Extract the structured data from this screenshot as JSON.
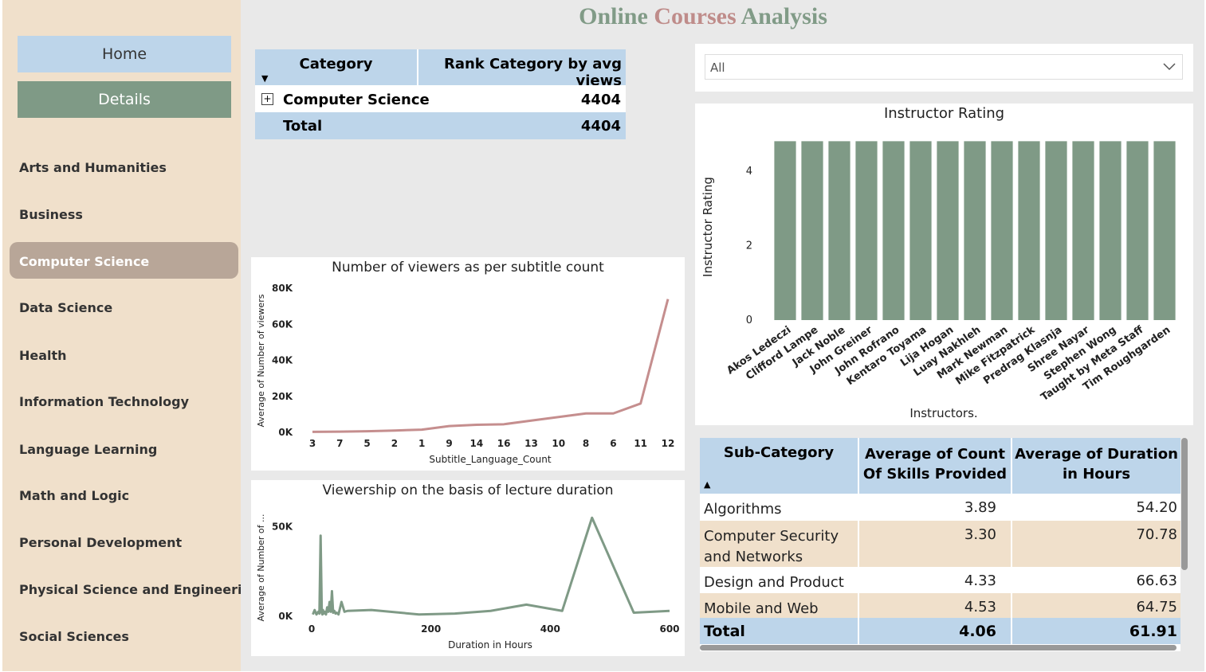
{
  "title": {
    "part1": "Online ",
    "part2": "Courses",
    "part3": " Analysis"
  },
  "colors": {
    "title1": "#819b87",
    "title2": "#bf8c8a",
    "title3": "#819b87",
    "bar": "#7f9a86",
    "line1": "#c58e8e",
    "line2": "#7f9a86",
    "header": "#bdd5ea",
    "band": "#f0e0cb"
  },
  "nav": {
    "home": "Home",
    "details": "Details"
  },
  "categories": [
    "Arts and Humanities",
    "Business",
    "Computer Science",
    "Data Science",
    "Health",
    "Information Technology",
    "Language Learning",
    "Math and Logic",
    "Personal Development",
    "Physical Science and Engineering",
    "Social Sciences"
  ],
  "active_category": "Computer Science",
  "rank_table": {
    "col1": "Category",
    "col2": "Rank Category by avg views",
    "expand_icon": "plus-box-icon",
    "row": {
      "name": "Computer Science",
      "value": "4404"
    },
    "total": {
      "name": "Total",
      "value": "4404"
    }
  },
  "filter": {
    "value": "All"
  },
  "subtable": {
    "col1": "Sub-Category",
    "col2": "Average of Count Of Skills Provided",
    "col3": "Average of Duration in Hours",
    "rows": [
      {
        "name": "Algorithms",
        "skills": "3.89",
        "duration": "54.20"
      },
      {
        "name": "Computer Security and Networks",
        "skills": "3.30",
        "duration": "70.78"
      },
      {
        "name": "Design and Product",
        "skills": "4.33",
        "duration": "66.63"
      },
      {
        "name": "Mobile and Web",
        "skills": "4.53",
        "duration": "64.75"
      }
    ],
    "total": {
      "name": "Total",
      "skills": "4.06",
      "duration": "61.91"
    }
  },
  "chart_data": [
    {
      "type": "line",
      "title": "Number of viewers as per subtitle count",
      "xlabel": "Subtitle_Language_Count",
      "ylabel": "Average of Number of viewers",
      "categories": [
        "3",
        "7",
        "5",
        "2",
        "1",
        "9",
        "14",
        "16",
        "13",
        "10",
        "8",
        "6",
        "11",
        "12"
      ],
      "values": [
        300,
        400,
        600,
        1000,
        1500,
        3500,
        4200,
        4500,
        6500,
        8500,
        10500,
        10500,
        16000,
        74000
      ],
      "yticks": [
        "0K",
        "20K",
        "40K",
        "60K",
        "80K"
      ],
      "ylim": [
        0,
        80000
      ]
    },
    {
      "type": "line",
      "title": "Viewership on the basis of lecture duration",
      "xlabel": "Duration in Hours",
      "ylabel": "Average of Number of ...",
      "xticks": [
        "0",
        "200",
        "400",
        "600"
      ],
      "yticks": [
        "0K",
        "50K"
      ],
      "xlim": [
        0,
        600
      ],
      "ylim": [
        0,
        60000
      ],
      "x": [
        2,
        5,
        8,
        11,
        13,
        15,
        17,
        18,
        19,
        20,
        22,
        24,
        26,
        28,
        30,
        32,
        34,
        36,
        38,
        40,
        42,
        45,
        50,
        55,
        60,
        100,
        180,
        240,
        300,
        360,
        420,
        470,
        540,
        600
      ],
      "values": [
        1000,
        3500,
        1000,
        2500,
        1500,
        45000,
        2000,
        1000,
        3500,
        1500,
        2500,
        1000,
        5000,
        2500,
        8000,
        2500,
        14000,
        2000,
        3000,
        1500,
        2000,
        1000,
        8000,
        2500,
        3000,
        3500,
        1000,
        1500,
        3000,
        6500,
        3000,
        55000,
        2000,
        3000
      ]
    },
    {
      "type": "bar",
      "title": "Instructor Rating",
      "xlabel": "Instructors.",
      "ylabel": "Instructor Rating",
      "categories": [
        "Akos Ledeczi",
        "Clifford Lampe",
        "Jack Noble",
        "John Greiner",
        "John Rofrano",
        "Kentaro Toyama",
        "Lija Hogan",
        "Luay Nakhleh",
        "Mark Newman",
        "Mike Fitzpatrick",
        "Predrag Klasnja",
        "Shree Nayar",
        "Stephen Wong",
        "Taught by Meta Staff",
        "Tim Roughgarden"
      ],
      "values": [
        4.8,
        4.8,
        4.8,
        4.8,
        4.8,
        4.8,
        4.8,
        4.8,
        4.8,
        4.8,
        4.8,
        4.8,
        4.8,
        4.8,
        4.8
      ],
      "yticks": [
        "0",
        "2",
        "4"
      ],
      "ylim": [
        0,
        5
      ]
    }
  ]
}
